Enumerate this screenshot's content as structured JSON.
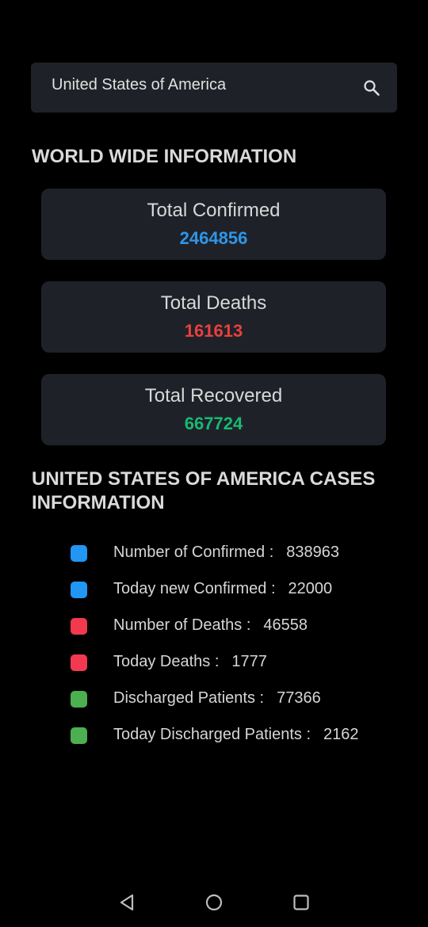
{
  "search": {
    "value": "United States of America"
  },
  "world": {
    "heading": "WORLD WIDE INFORMATION",
    "cards": [
      {
        "label": "Total Confirmed",
        "value": "2464856",
        "color": "#2f95e8"
      },
      {
        "label": "Total Deaths",
        "value": "161613",
        "color": "#e8403f"
      },
      {
        "label": "Total Recovered",
        "value": "667724",
        "color": "#19b872"
      }
    ]
  },
  "country": {
    "heading_line1": "UNITED STATES OF AMERICA CASES",
    "heading_line2": "INFORMATION",
    "items": [
      {
        "label": "Number of Confirmed :",
        "value": "838963",
        "color": "#2196f3"
      },
      {
        "label": "Today new Confirmed :",
        "value": "22000",
        "color": "#2196f3"
      },
      {
        "label": "Number of Deaths :",
        "value": "46558",
        "color": "#f2394f"
      },
      {
        "label": "Today Deaths :",
        "value": "1777",
        "color": "#f2394f"
      },
      {
        "label": "Discharged Patients :",
        "value": "77366",
        "color": "#4caf50"
      },
      {
        "label": "Today Discharged Patients :",
        "value": "2162",
        "color": "#4caf50"
      }
    ]
  },
  "nav": {
    "icons": [
      "back-icon",
      "home-icon",
      "recents-icon"
    ]
  }
}
